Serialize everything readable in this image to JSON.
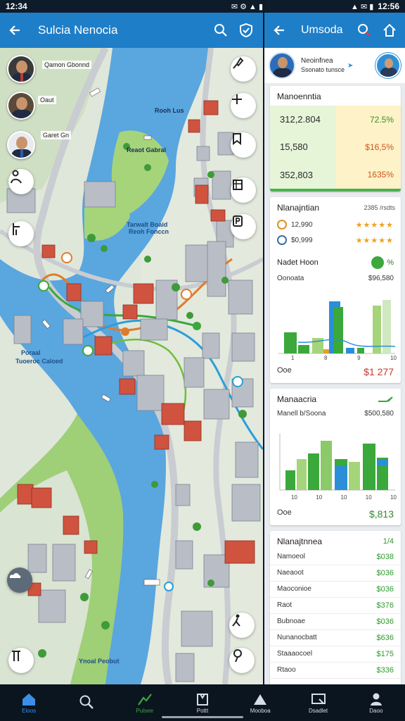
{
  "status_left": {
    "time": "12:34",
    "icons": "✉ ⚙ ▲ ▮"
  },
  "status_right": {
    "time": "12:56",
    "icons": "▲ ✉ ▮"
  },
  "map_app": {
    "title": "Sulcia Nenocia",
    "labels": [
      "Qamon Gbonnd",
      "Oaut",
      "Garet Gn",
      "Rooh Lus",
      "Tarwalt Boaid",
      "Reoh Fonccn",
      "Poraal",
      "Tuoeroc Caloed",
      "Ynoal Peobut",
      "Reaot Gabral"
    ]
  },
  "panel": {
    "title": "Umsoda",
    "profile": {
      "name": "Neoinfnea",
      "sub": "Ssonato tunsce"
    },
    "card1": {
      "title": "Manoenntia",
      "rows": [
        {
          "left": "312,2.804",
          "right": "72.5%"
        },
        {
          "left": "15,580",
          "right": "$16,5%"
        },
        {
          "left": "352,803",
          "right": "1635%"
        }
      ]
    },
    "card2": {
      "title": "Nlanajntian",
      "title_value": "2385 /rsdts",
      "ratings": [
        {
          "label": "12,990",
          "stars": "★★★★★"
        },
        {
          "label": "$0,999",
          "stars": "★★★★★"
        }
      ],
      "sub_title": "Nadet Hoon",
      "sub_pct": "%",
      "chart_title": "Oonoata",
      "chart_value": "$96,580",
      "axis": [
        "1",
        "8",
        "9",
        "10"
      ],
      "foot_label": "Ooe",
      "foot_value": "$1 277"
    },
    "card3": {
      "title": "Manaacria",
      "sub_title": "Manell b/Soona",
      "sub_value": "$500,580",
      "axis": [
        "10",
        "10",
        "10",
        "10",
        "10"
      ],
      "foot_label": "Ooe",
      "foot_value": "$,813"
    },
    "card4": {
      "title": "Nlanajtnnea",
      "title_value": "1/4",
      "rows": [
        {
          "label": "Namoeol",
          "value": "$038"
        },
        {
          "label": "Naeaoot",
          "value": "$036"
        },
        {
          "label": "Maoconioe",
          "value": "$036"
        },
        {
          "label": "Raot",
          "value": "$376"
        },
        {
          "label": "Bubnoae",
          "value": "$036"
        },
        {
          "label": "Nunanocbatt",
          "value": "$636"
        },
        {
          "label": "Staaaocoel",
          "value": "$175"
        },
        {
          "label": "Rtaoo",
          "value": "$336"
        }
      ]
    }
  },
  "nav": [
    {
      "label": "Eloos"
    },
    {
      "label": ""
    },
    {
      "label": "Pulsee"
    },
    {
      "label": "Pottt"
    },
    {
      "label": "Mooboa"
    },
    {
      "label": "Dsadlet"
    },
    {
      "label": "Daoo"
    }
  ],
  "colors": {
    "header_blue": "#1e7ec8",
    "water": "#5aa6df",
    "park": "#a6d47a",
    "accent_green": "#3aa83a"
  }
}
